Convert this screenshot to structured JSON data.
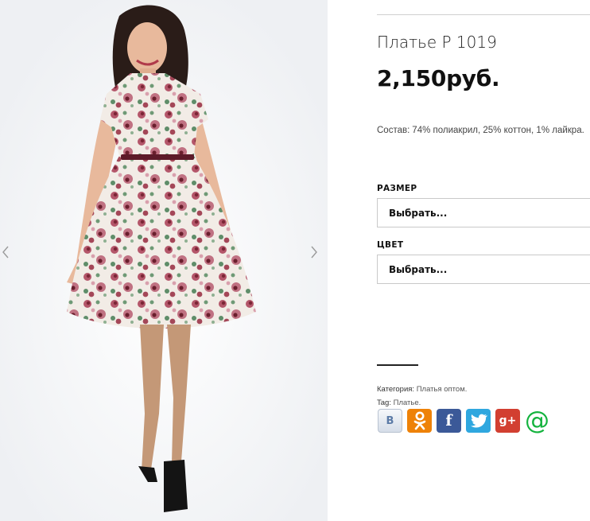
{
  "gallery": {
    "image_alt": "Платье Р 1019 — модель в платье с цветочным принтом",
    "prev_icon": "chevron-left-icon",
    "next_icon": "chevron-right-icon"
  },
  "product": {
    "title": "Платье Р 1019",
    "price": "2,150руб.",
    "composition_label": "Состав:",
    "composition_value": "74% полиакрил, 25% коттон, 1% лайкра."
  },
  "options": {
    "size": {
      "label": "РАЗМЕР",
      "selected": "Выбрать..."
    },
    "color": {
      "label": "ЦВЕТ",
      "selected": "Выбрать..."
    }
  },
  "meta": {
    "category_label": "Категория:",
    "category_value": "Платья оптом.",
    "tag_label": "Tag:",
    "tag_value": "Платье."
  },
  "share": {
    "vk_glyph": "В",
    "fb_glyph": "f",
    "gp_glyph": "g+",
    "mail_glyph": "@",
    "icons": [
      "vk-icon",
      "odnoklassniki-icon",
      "facebook-icon",
      "twitter-icon",
      "google-plus-icon",
      "mail-ru-icon"
    ]
  },
  "colors": {
    "accent_text": "#111111",
    "rule": "#cfcfcf",
    "odnoklassniki": "#ee8208",
    "facebook": "#3b5998",
    "twitter": "#2fa7df",
    "google_plus": "#d23f31",
    "mail_ru": "#14b33e"
  }
}
